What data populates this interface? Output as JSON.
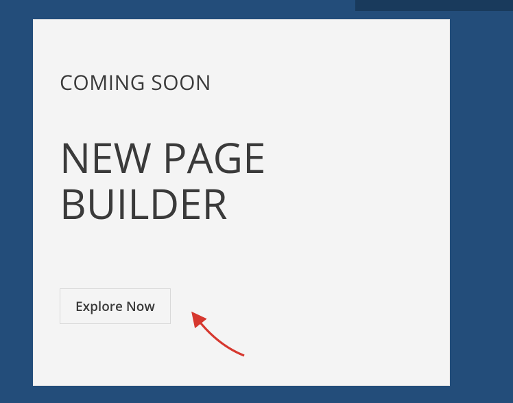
{
  "card": {
    "subheading": "COMING SOON",
    "heading": "NEW PAGE BUILDER",
    "cta_label": "Explore Now"
  },
  "colors": {
    "page_bg": "#234d7a",
    "card_bg": "#f4f4f4",
    "text": "#3a3a3a",
    "arrow": "#d6382f"
  }
}
